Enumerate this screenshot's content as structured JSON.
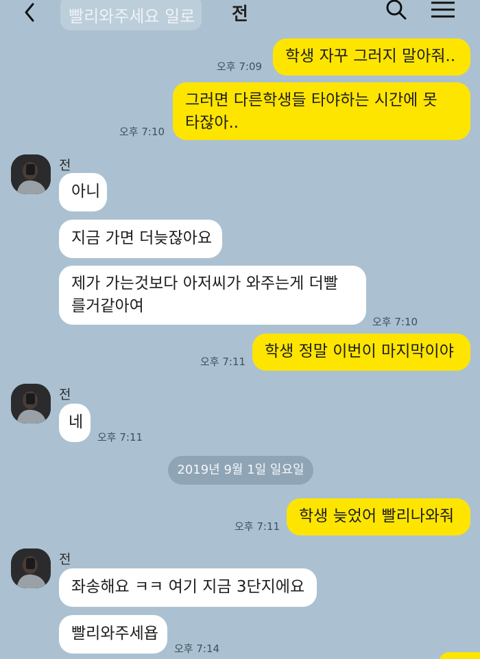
{
  "header": {
    "title": "전",
    "pinned_notice": "빨리와주세요 일로"
  },
  "messages": [
    {
      "side": "me",
      "lines": [
        "학생 자꾸 그러지 말아줘.."
      ],
      "time": "오후 7:09"
    },
    {
      "side": "me",
      "lines": [
        "그러면 다른학생들 타야하는 시간에 못",
        "타잖아.."
      ],
      "time": "오후 7:10"
    },
    {
      "side": "you",
      "lines": [
        "아니"
      ]
    },
    {
      "side": "you",
      "lines": [
        "지금 가면 더늦잖아요"
      ]
    },
    {
      "side": "you",
      "lines": [
        "제가 가는것보다 아저씨가 와주는게 더빨",
        "를거같아여"
      ],
      "time": "오후 7:10"
    },
    {
      "side": "me",
      "lines": [
        "학생 정말 이번이 마지막이야"
      ],
      "time": "오후 7:11"
    },
    {
      "side": "you",
      "lines": [
        "네"
      ],
      "time": "오후 7:11"
    },
    {
      "side": "me",
      "lines": [
        "학생 늦었어 빨리나와줘"
      ],
      "time": "오후 7:11"
    },
    {
      "side": "you",
      "lines": [
        "좌송해요 ㅋㅋ 여기 지금 3단지에요"
      ]
    },
    {
      "side": "you",
      "lines": [
        "빨리와주세욥"
      ],
      "time": "오후 7:14"
    }
  ],
  "sender_name": "전",
  "date_divider": "2019년 9월 1일 일요일",
  "colors": {
    "background": "#abc1d1",
    "my_bubble": "#fee500",
    "their_bubble": "#ffffff"
  },
  "icons": [
    "back-arrow-icon",
    "search-icon",
    "menu-icon"
  ]
}
